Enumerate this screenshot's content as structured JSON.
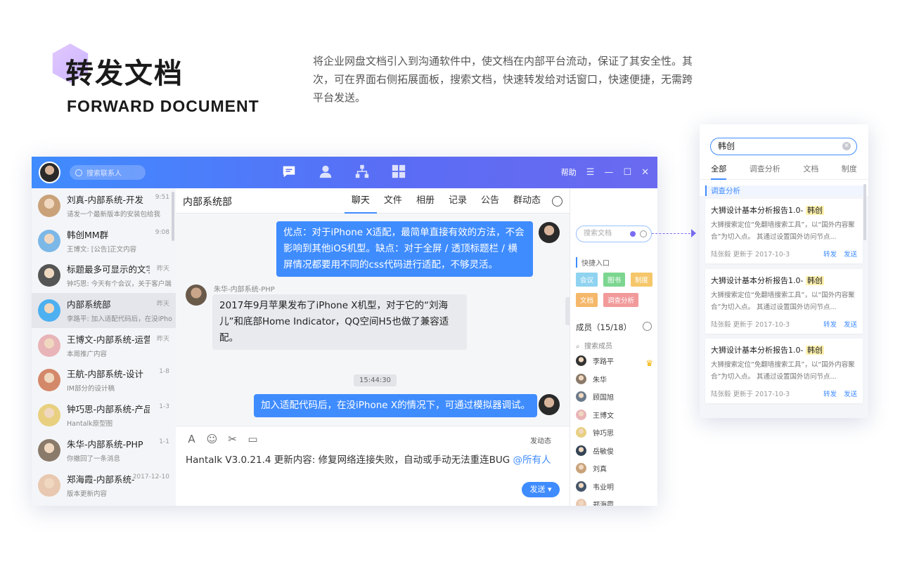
{
  "page": {
    "title": "转发文档",
    "subtitle": "FORWARD DOCUMENT",
    "description": "将企业网盘文档引入到沟通软件中，使文档在内部平台流动，保证了其安全性。其次，可在界面右侧拓展面板，搜索文档，快速转发给对话窗口，快速便捷，无需跨平台发送。"
  },
  "titlebar": {
    "search_placeholder": "搜索联系人",
    "help_label": "帮助",
    "menu_icon": "☰",
    "min_icon": "—",
    "max_icon": "☐",
    "close_icon": "✕"
  },
  "conversations": [
    {
      "name": "刘真-内部系统-开发",
      "time": "9:51",
      "msg": "请发一个最新版本的安装包给我",
      "color": "#c9a27a"
    },
    {
      "name": "韩创MM群",
      "time": "9:08",
      "msg": "王博文: [公告]正文内容",
      "color": "#7bb8e8"
    },
    {
      "name": "标题最多可显示的文字",
      "time": "昨天",
      "msg": "钟巧思: 今天有个会议，关于客户端",
      "color": "#555555"
    },
    {
      "name": "内部系统部",
      "time": "昨天",
      "msg": "李路平: 加入适配代码后，在没iPho",
      "color": "#4db0f0"
    },
    {
      "name": "王博文-内部系统-运营",
      "time": "昨天",
      "msg": "本周推广内容",
      "color": "#e8b4b8"
    },
    {
      "name": "王航-内部系统-设计",
      "time": "1-8",
      "msg": "IM部分的设计稿",
      "color": "#d4886a"
    },
    {
      "name": "钟巧思-内部系统-产品",
      "time": "1-3",
      "msg": "Hantalk原型图",
      "color": "#e8d080"
    },
    {
      "name": "朱华-内部系统-PHP",
      "time": "1-1",
      "msg": "你撤回了一条消息",
      "color": "#8a7a6a"
    },
    {
      "name": "郑海霞-内部系统-",
      "time": "2017-12-10",
      "msg": "版本更新内容",
      "color": "#e8c8b0"
    }
  ],
  "chat": {
    "name": "内部系统部",
    "tabs": [
      "聊天",
      "文件",
      "相册",
      "记录",
      "公告",
      "群动态"
    ],
    "messages": {
      "m1": "优点：对于iPhone X适配，最简单直接有效的方法，不会影响到其他iOS机型。缺点：对于全屏 / 透顶标题栏 / 横屏情况都要用不同的css代码进行适配，不够灵活。",
      "m2_sender": "朱华-内部系统-PHP",
      "m2": "2017年9月苹果发布了iPhone X机型，对于它的“刘海儿”和底部Home Indicator，QQ空间H5也做了兼容适配。",
      "time": "15:44:30",
      "m3": "加入适配代码后，在没iPhone X的情况下，可通过模拟器调试。"
    },
    "composer": {
      "dynamic_label": "发动态",
      "text": "Hantalk V3.0.21.4 更新内容: 修复网络连接失败，自动或手动无法重连BUG ",
      "mention": "@所有人",
      "send_label": "发送 ▾"
    }
  },
  "side_panel": {
    "search_placeholder": "搜索文档",
    "quick_title": "快捷入口",
    "tags": [
      {
        "label": "会议",
        "color": "#8fd3f0"
      },
      {
        "label": "图书",
        "color": "#7cd690"
      },
      {
        "label": "制度",
        "color": "#f5c76a"
      },
      {
        "label": "文档",
        "color": "#f5b86a"
      },
      {
        "label": "调查分析",
        "color": "#f29a9a"
      }
    ],
    "members_title": "成员（15/18）",
    "member_search": "搜索成员",
    "members": [
      {
        "name": "李路平",
        "color": "#333333"
      },
      {
        "name": "朱华",
        "color": "#8a7a6a"
      },
      {
        "name": "顾国旭",
        "color": "#6a7a8a"
      },
      {
        "name": "王博文",
        "color": "#e8b4b8"
      },
      {
        "name": "钟巧思",
        "color": "#e8d080"
      },
      {
        "name": "岳敏俊",
        "color": "#334455"
      },
      {
        "name": "刘真",
        "color": "#c9a27a"
      },
      {
        "name": "韦业明",
        "color": "#44556a"
      },
      {
        "name": "郑海霞",
        "color": "#e8c8b0"
      }
    ]
  },
  "doc_search": {
    "query": "韩创",
    "tabs": [
      "全部",
      "调查分析",
      "文档",
      "制度"
    ],
    "section": "调查分析",
    "results": [
      {
        "title": "大狮设计基本分析报告1.0- ",
        "highlight": "韩创",
        "desc": "大狮搜索定位“免翻墙搜索工具”，以“国外内容聚合”为切入点。 其通过设置国外访问节点...",
        "meta": "陆张毅 更新于 2017-10-3",
        "forward": "转发",
        "send": "发送"
      },
      {
        "title": "大狮设计基本分析报告1.0- ",
        "highlight": "韩创",
        "desc": "大狮搜索定位“免翻墙搜索工具”，以“国外内容聚合”为切入点。 其通过设置国外访问节点...",
        "meta": "陆张毅 更新于 2017-10-3",
        "forward": "转发",
        "send": "发送"
      },
      {
        "title": "大狮设计基本分析报告1.0- ",
        "highlight": "韩创",
        "desc": "大狮搜索定位“免翻墙搜索工具”，以“国外内容聚合”为切入点。 其通过设置国外访问节点...",
        "meta": "陆张毅 更新于 2017-10-3",
        "forward": "转发",
        "send": "发送"
      }
    ]
  }
}
